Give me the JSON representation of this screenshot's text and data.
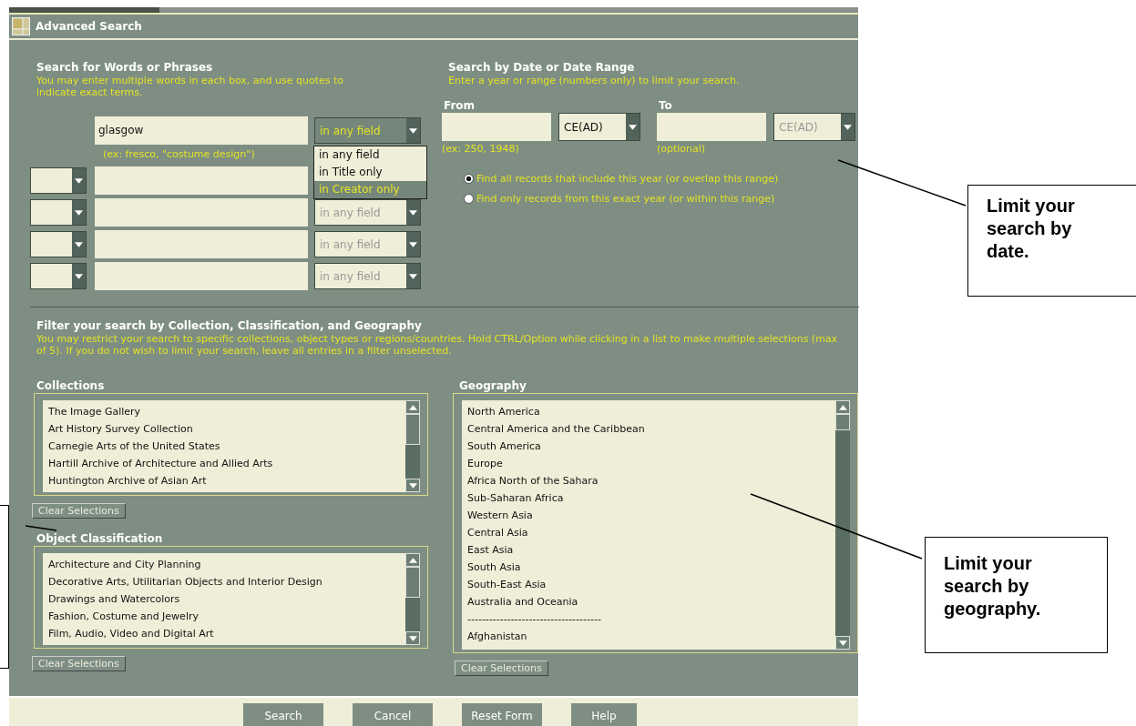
{
  "window": {
    "title": "Advanced Search"
  },
  "words": {
    "heading": "Search for Words or Phrases",
    "help": "You may enter multiple words in each box, and use quotes to indicate exact terms.",
    "hint": "(ex: fresco, \"costume design\")",
    "rows": [
      {
        "kind": "first",
        "value": "glasgow",
        "field": "in any field",
        "field_enabled": true
      },
      {
        "kind": "extra"
      },
      {
        "kind": "extra",
        "field": "in any field",
        "field_enabled": false
      },
      {
        "kind": "extra",
        "field": "in any field",
        "field_enabled": false
      },
      {
        "kind": "extra",
        "field": "in any field",
        "field_enabled": false
      }
    ],
    "dropdown": [
      {
        "label": "in any field",
        "selected": false
      },
      {
        "label": "in Title only",
        "selected": false
      },
      {
        "label": "in Creator only",
        "selected": true
      }
    ]
  },
  "date": {
    "heading": "Search by Date or Date Range",
    "help": "Enter a year or range (numbers only) to limit your search.",
    "from_label": "From",
    "from_era": "CE(AD)",
    "from_era_enabled": true,
    "from_hint": "(ex: 250, 1948)",
    "to_label": "To",
    "to_era": "CE(AD)",
    "to_era_enabled": false,
    "to_hint": "(optional)",
    "options": [
      {
        "label": "Find all records that include this year (or overlap this range)",
        "selected": true
      },
      {
        "label": "Find only records from this exact year (or within this range)",
        "selected": false
      }
    ]
  },
  "filters": {
    "heading": "Filter your search by Collection, Classification, and Geography",
    "help": "You may restrict your search to specific collections, object types or regions/countries. Hold CTRL/Option while clicking in a list to make multiple selections (max of 5). If you do not wish to limit your search, leave all entries in a filter unselected.",
    "lists": [
      {
        "title": "Collections",
        "items": [
          "The Image Gallery",
          "Art History Survey Collection",
          "Carnegie Arts of the United States",
          "Hartill Archive of Architecture and Allied Arts",
          "Huntington Archive of Asian Art"
        ],
        "clear": "Clear Selections"
      },
      {
        "title": "Object Classification",
        "items": [
          "Architecture and City Planning",
          "Decorative Arts, Utilitarian Objects and Interior Design",
          "Drawings and Watercolors",
          "Fashion, Costume and Jewelry",
          "Film, Audio, Video and Digital Art"
        ],
        "clear": "Clear Selections"
      },
      {
        "title": "Geography",
        "items": [
          "North America",
          "Central America and the Caribbean",
          "South America",
          "Europe",
          "Africa North of the Sahara",
          "Sub-Saharan Africa",
          "Western Asia",
          "Central Asia",
          "East Asia",
          "South Asia",
          "South-East Asia",
          "Australia and Oceania",
          "-------------------------------------",
          "Afghanistan"
        ],
        "clear": "Clear Selections"
      }
    ]
  },
  "buttons": [
    "Search",
    "Cancel",
    "Reset Form",
    "Help"
  ],
  "callouts": [
    {
      "text": "Limit your search by date."
    },
    {
      "text": "Limit your search by geography."
    }
  ]
}
